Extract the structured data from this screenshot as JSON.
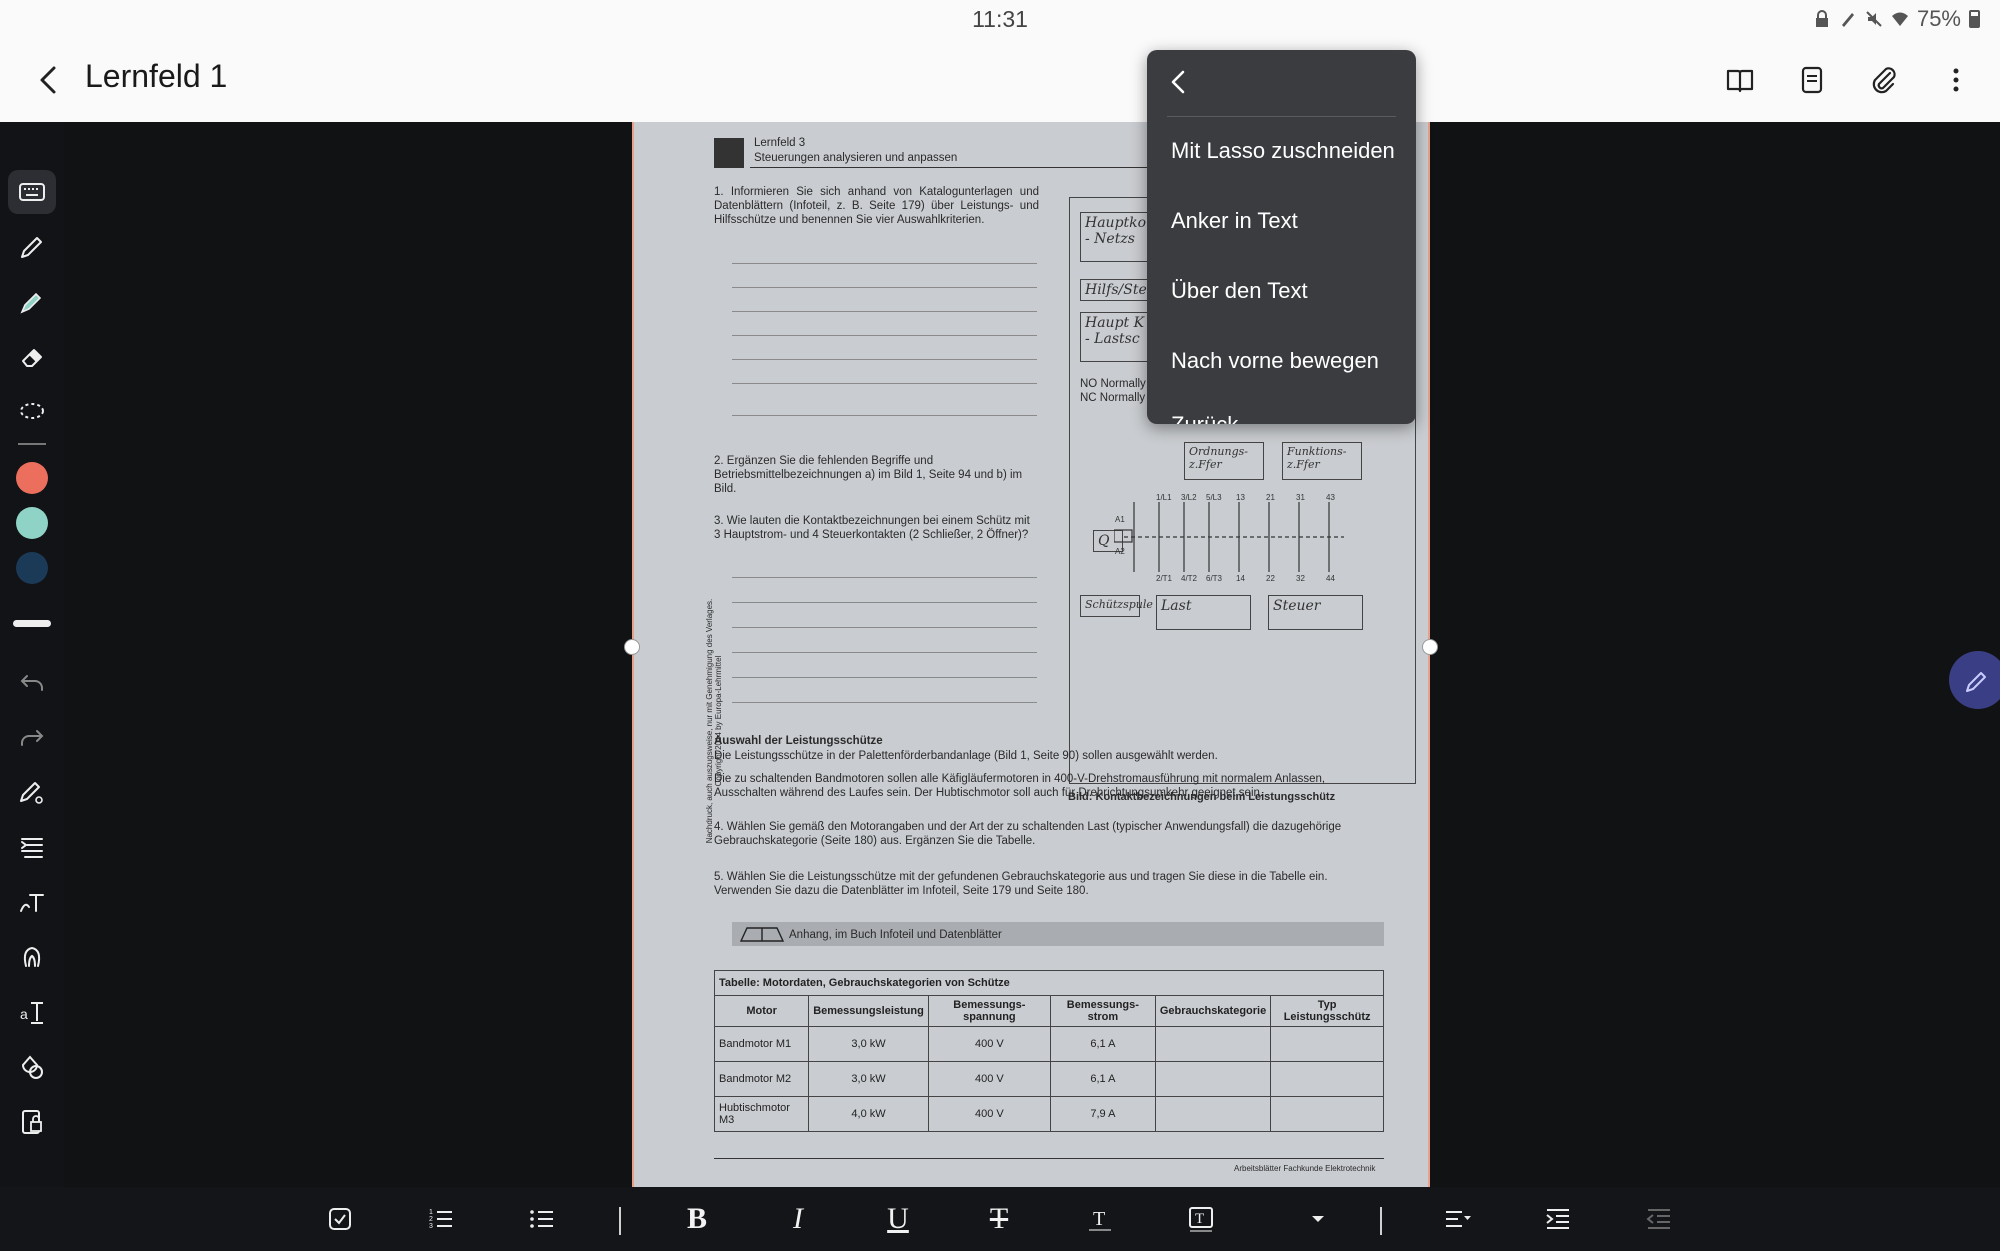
{
  "status": {
    "time": "11:31",
    "battery": "75%"
  },
  "appbar": {
    "title": "Lernfeld 1"
  },
  "menu": {
    "items": [
      "Mit Lasso zuschneiden",
      "Anker in Text",
      "Über den Text",
      "Nach vorne bewegen",
      "Zurück"
    ]
  },
  "colors": {
    "pen1": "#ec6f5d",
    "pen2": "#8fd3c6",
    "pen3": "#1b3a57",
    "accent": "#3a3f85"
  },
  "doc": {
    "header_line1": "Lernfeld 3",
    "header_line2": "Steuerungen analysieren und anpassen",
    "q1": "1.  Informieren Sie sich anhand von Katalogunterlagen und Datenblättern (Infoteil, z. B. Seite 179) über Leistungs- und Hilfsschütze und benennen Sie vier Auswahlkriterien.",
    "q2": "2.  Ergänzen Sie die fehlenden Begriffe und Betriebsmittelbezeichnungen a) im Bild 1, Seite 94 und b) im Bild.",
    "q3": "3.  Wie lauten die Kontaktbezeichnungen bei einem Schütz mit 3 Hauptstrom- und 4 Steuerkontakten (2 Schließer, 2 Öffner)?",
    "no_line": "NO Normally",
    "nc_line": "NC Normally",
    "hw1": "Hauptko - Netzs",
    "hw2": "Hilfs/Steu",
    "hw3": "Haupt K - Lastsc",
    "hw_ord": "Ordnungs- z.Ffer",
    "hw_fkt": "Funktions- z.Ffer",
    "hw_q": "Q",
    "hw_spule": "Schützspule",
    "hw_last": "Last",
    "hw_steuer": "Steuer",
    "bild_caption": "Bild: Kontaktbezeichnungen beim Leistungsschütz",
    "section_title": "Auswahl der Leistungsschütze",
    "section_text1": "Die Leistungsschütze in der Palettenförderbandanlage (Bild 1, Seite 90) sollen ausgewählt werden.",
    "section_text2": "Die zu schaltenden Bandmotoren sollen alle Käfigläufermotoren in 400-V-Drehstromausführung mit normalem Anlassen, Ausschalten während des Laufes sein. Der Hubtischmotor soll auch für Drehrichtungsumkehr geeignet sein.",
    "q4": "4.  Wählen Sie gemäß den Motorangaben und der Art der zu schaltenden Last (typischer Anwendungsfall) die dazugehörige Gebrauchskategorie (Seite 180) aus. Ergänzen Sie die Tabelle.",
    "q5": "5.  Wählen Sie die Leistungsschütze mit der gefundenen Gebrauchskategorie aus und tragen Sie diese in die Tabelle ein. Verwenden Sie dazu die Datenblätter im Infoteil, Seite 179 und Seite 180.",
    "book_note": "Anhang, im Buch Infoteil und Datenblätter",
    "side_note": "Nachdruck, auch auszugsweise, nur mit Genehmigung des Verlages. Copyright 2014 by Europa-Lehrmittel",
    "footer": "Arbeitsblätter Fachkunde Elektrotechnik",
    "table": {
      "caption": "Tabelle: Motordaten, Gebrauchskategorien von Schütze",
      "headers": [
        "Motor",
        "Bemessungsleistung",
        "Bemessungs-spannung",
        "Bemessungs-strom",
        "Gebrauchskategorie",
        "Typ Leistungsschütz"
      ],
      "rows": [
        [
          "Bandmotor M1",
          "3,0 kW",
          "400 V",
          "6,1 A",
          "",
          ""
        ],
        [
          "Bandmotor M2",
          "3,0 kW",
          "400 V",
          "6,1 A",
          "",
          ""
        ],
        [
          "Hubtischmotor M3",
          "4,0 kW",
          "400 V",
          "7,9 A",
          "",
          ""
        ]
      ]
    },
    "contact_labels": [
      "1/L1",
      "3/L2",
      "5/L3",
      "13",
      "21",
      "31",
      "43",
      "2/T1",
      "4/T2",
      "6/T3",
      "14",
      "22",
      "32",
      "44",
      "A1",
      "A2"
    ]
  }
}
